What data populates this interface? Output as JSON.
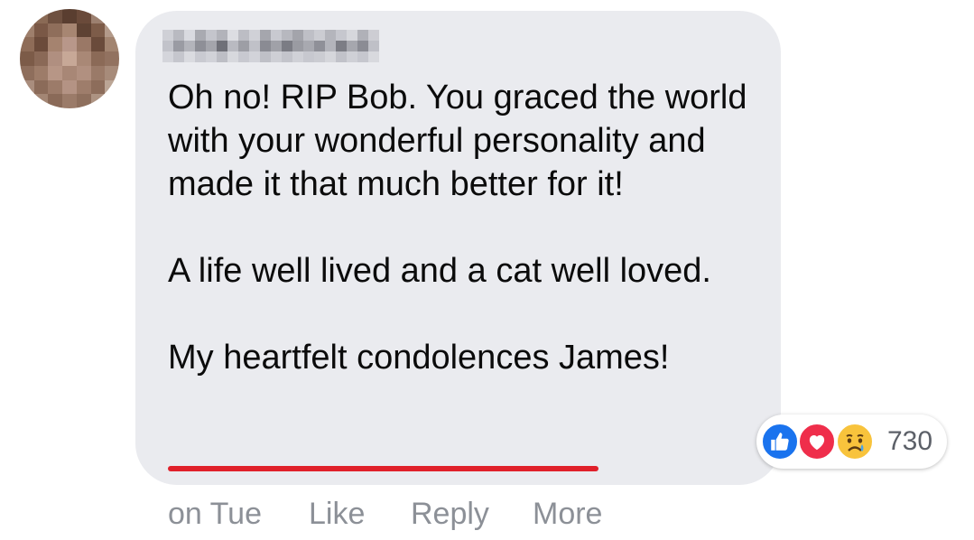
{
  "comment": {
    "author_name": "",
    "paragraphs": [
      "Oh no! RIP Bob. You graced the world with your wonderful personality and made it that much better for it!",
      "A life well lived and a cat well loved."
    ],
    "last_line_underlined": "My heartfelt condolences",
    "last_line_rest": " James!"
  },
  "reactions": {
    "icons": [
      "like-icon",
      "love-icon",
      "sad-icon"
    ],
    "count": "730",
    "colors": {
      "like": "#1a73ee",
      "love": "#ef2e4b",
      "sad": "#f8c33c"
    }
  },
  "actions": {
    "timestamp": "on Tue",
    "like_label": "Like",
    "reply_label": "Reply",
    "more_label": "More"
  },
  "colors": {
    "bubble": "#eaebef",
    "text": "#0b0b0b",
    "muted": "#8c9097",
    "underline": "#e0202a"
  }
}
